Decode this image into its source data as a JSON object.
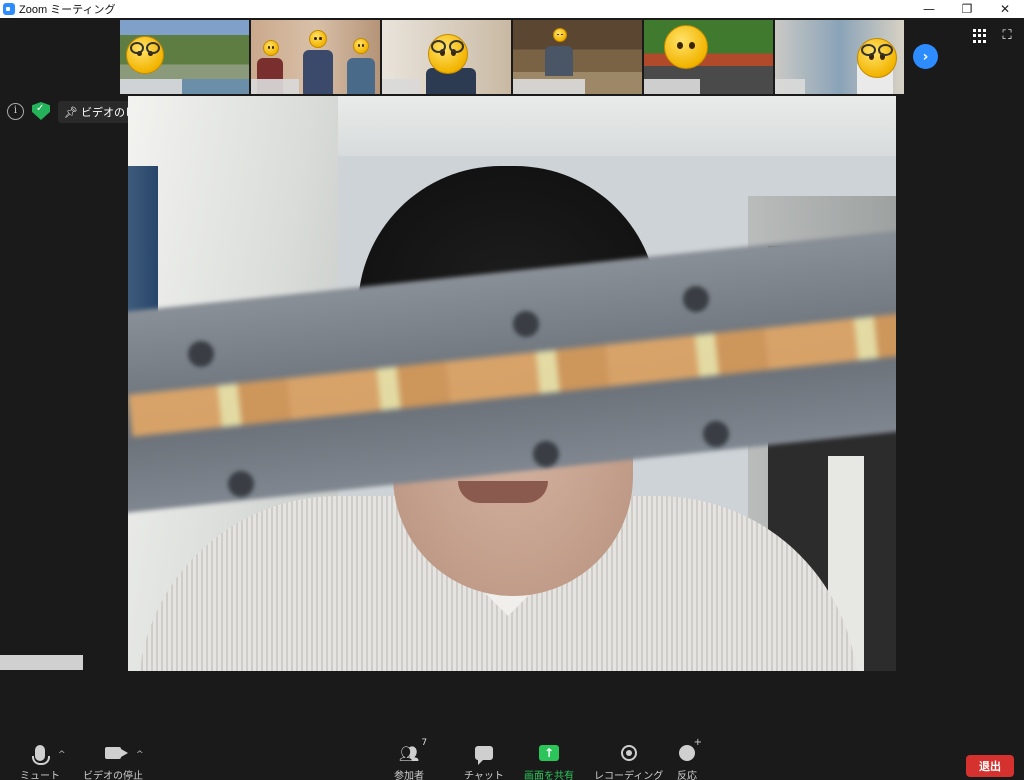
{
  "window": {
    "title": "Zoom ミーティング",
    "controls": {
      "minimize": "—",
      "restore": "❐",
      "close": "✕"
    }
  },
  "gallery": {
    "next_icon": "chevron-right-icon",
    "thumbnails": [
      {
        "scene": "vineyard",
        "emoji": "glasses-face"
      },
      {
        "scene": "office-three-people",
        "emoji": "small-faces"
      },
      {
        "scene": "living-room",
        "emoji": "surprised-glasses"
      },
      {
        "scene": "dining-room",
        "emoji": "small-face"
      },
      {
        "scene": "train",
        "emoji": "confused-face"
      },
      {
        "scene": "shelves",
        "emoji": "tongue-glasses"
      }
    ]
  },
  "view_controls": {
    "grid_icon": "gallery-view-icon",
    "fullscreen_icon": "fullscreen-icon"
  },
  "info_bar": {
    "info_icon": "i",
    "unpin_label": "ビデオのピン留めを解除"
  },
  "toolbar": {
    "mute_label": "ミュート",
    "video_label": "ビデオの停止",
    "participants_label": "参加者",
    "participants_count": "7",
    "chat_label": "チャット",
    "share_label": "画面を共有",
    "share_glyph": "↑",
    "record_label": "レコーディング",
    "reactions_label": "反応",
    "leave_label": "退出"
  },
  "colors": {
    "accent": "#2d8cff",
    "share_green": "#2cc55a",
    "leave_red": "#d4312f",
    "background": "#1a1a1a"
  }
}
